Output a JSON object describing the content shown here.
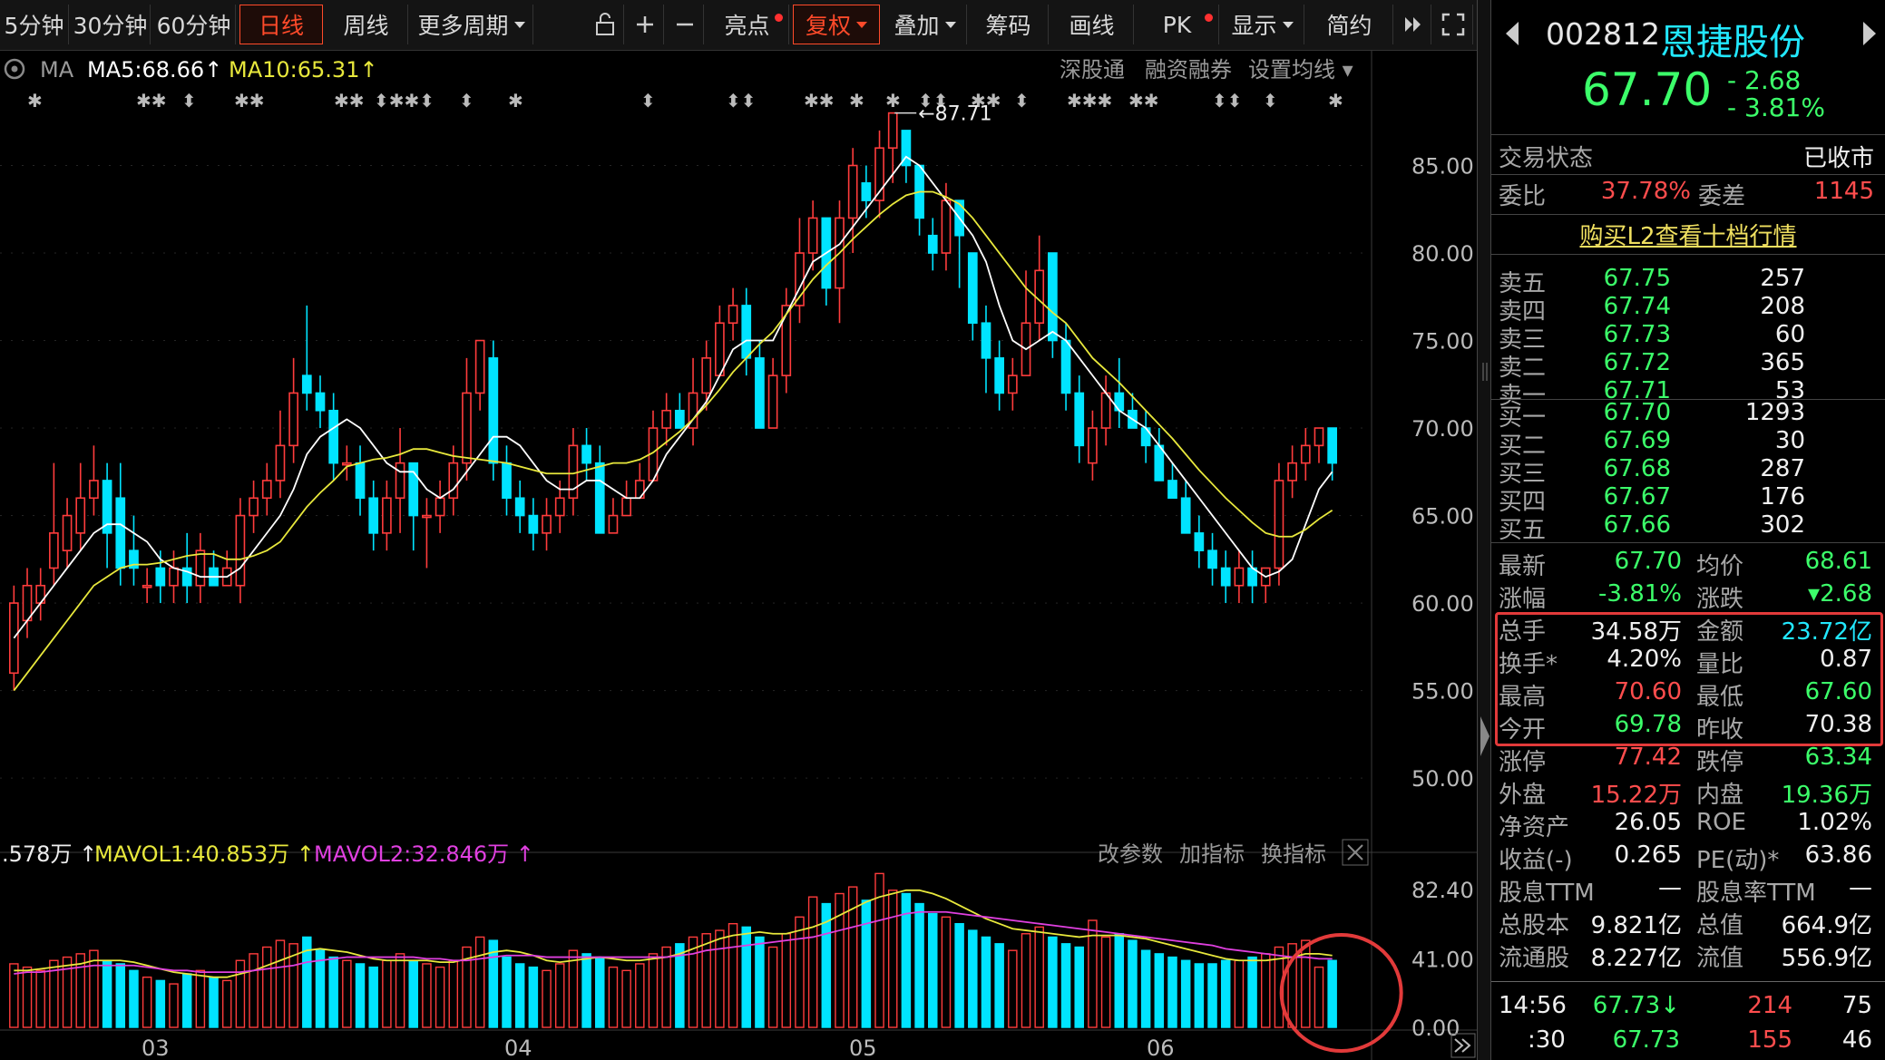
{
  "toolbar": {
    "periods": [
      "5分钟",
      "30分钟",
      "60分钟",
      "日线",
      "周线",
      "更多周期"
    ],
    "active_period": "日线",
    "tools": [
      "亮点",
      "复权",
      "叠加",
      "筹码",
      "画线",
      "PK",
      "显示",
      "简约"
    ],
    "icons": [
      "lock-icon",
      "plus-icon",
      "minus-icon"
    ]
  },
  "ma_legend": {
    "title": "MA",
    "ma5": "MA5:68.66",
    "ma10": "MA10:65.31",
    "arrow": "↑"
  },
  "chart_links": [
    "深股通",
    "融资融券",
    "设置均线"
  ],
  "vol_legend": {
    "vol": ".578万",
    "mavol1": "MAVOL1:40.853万",
    "mavol2": "MAVOL2:32.846万",
    "arrow": "↑"
  },
  "vol_links": [
    "改参数",
    "加指标",
    "换指标"
  ],
  "x_labels": [
    "03",
    "04",
    "05",
    "06"
  ],
  "price_axis": [
    "85.00",
    "80.00",
    "75.00",
    "70.00",
    "65.00",
    "60.00",
    "55.00",
    "50.00"
  ],
  "vol_axis": [
    "82.40",
    "41.00",
    "0.00"
  ],
  "peak_label": "87.71",
  "colors": {
    "up": "#ff3c3c",
    "down": "#00e4ff",
    "ma5": "#ffffff",
    "ma10": "#e8e83c",
    "mavol1": "#e8e83c",
    "mavol2": "#e040e0"
  },
  "chart_data": {
    "type": "candlestick",
    "ylim": [
      47,
      90
    ],
    "vol_ylim": [
      0,
      96
    ],
    "candles": [
      [
        56,
        60,
        61,
        55
      ],
      [
        59,
        61,
        62,
        58
      ],
      [
        60,
        61,
        62,
        59
      ],
      [
        62,
        64,
        68,
        61
      ],
      [
        63,
        65,
        66,
        62
      ],
      [
        64,
        66,
        68,
        63
      ],
      [
        66,
        67,
        69,
        65
      ],
      [
        67,
        64,
        68,
        62
      ],
      [
        66,
        62,
        68,
        61
      ],
      [
        63,
        62,
        65,
        61
      ],
      [
        61,
        61,
        62,
        60
      ],
      [
        62,
        61,
        63,
        60
      ],
      [
        61,
        62,
        63,
        60
      ],
      [
        62,
        61,
        64,
        60
      ],
      [
        61,
        63,
        64,
        60
      ],
      [
        62,
        61,
        63,
        61
      ],
      [
        61,
        62,
        63,
        61
      ],
      [
        61,
        65,
        66,
        60
      ],
      [
        65,
        66,
        67,
        64
      ],
      [
        66,
        67,
        68,
        65
      ],
      [
        67,
        69,
        71,
        66
      ],
      [
        69,
        72,
        74,
        68
      ],
      [
        73,
        72,
        77,
        71
      ],
      [
        72,
        71,
        73,
        70
      ],
      [
        71,
        68,
        72,
        67
      ],
      [
        68,
        68,
        69,
        67
      ],
      [
        68,
        66,
        69,
        65
      ],
      [
        66,
        64,
        67,
        63
      ],
      [
        64,
        66,
        67,
        63
      ],
      [
        66,
        68,
        70,
        64
      ],
      [
        68,
        65,
        68,
        63
      ],
      [
        65,
        65,
        66,
        62
      ],
      [
        65,
        66,
        67,
        64
      ],
      [
        66,
        68,
        69,
        65
      ],
      [
        68,
        72,
        74,
        67
      ],
      [
        72,
        75,
        75,
        71
      ],
      [
        74,
        68,
        75,
        67
      ],
      [
        68,
        66,
        69,
        65
      ],
      [
        66,
        65,
        67,
        64
      ],
      [
        65,
        64,
        66,
        63
      ],
      [
        64,
        65,
        66,
        63
      ],
      [
        65,
        66,
        67,
        64
      ],
      [
        66,
        69,
        70,
        65
      ],
      [
        69,
        68,
        70,
        67
      ],
      [
        68,
        64,
        69,
        64
      ],
      [
        64,
        65,
        66,
        64
      ],
      [
        65,
        66,
        67,
        65
      ],
      [
        66,
        67,
        68,
        66
      ],
      [
        67,
        70,
        71,
        67
      ],
      [
        70,
        71,
        72,
        69
      ],
      [
        71,
        70,
        72,
        70
      ],
      [
        70,
        72,
        74,
        69
      ],
      [
        72,
        74,
        75,
        71
      ],
      [
        73,
        76,
        77,
        73
      ],
      [
        76,
        77,
        78,
        75
      ],
      [
        77,
        74,
        78,
        73
      ],
      [
        74,
        70,
        75,
        70
      ],
      [
        70,
        73,
        74,
        70
      ],
      [
        73,
        77,
        78,
        72
      ],
      [
        77,
        80,
        82,
        76
      ],
      [
        80,
        82,
        83,
        79
      ],
      [
        82,
        78,
        82,
        77
      ],
      [
        78,
        82,
        83,
        76
      ],
      [
        82,
        85,
        86,
        80
      ],
      [
        84,
        83,
        85,
        82
      ],
      [
        83,
        86,
        87,
        82
      ],
      [
        86,
        88,
        88,
        84
      ],
      [
        87,
        85,
        87,
        84
      ],
      [
        85,
        82,
        85,
        81
      ],
      [
        81,
        80,
        82,
        79
      ],
      [
        80,
        83,
        84,
        79
      ],
      [
        83,
        81,
        83,
        78
      ],
      [
        80,
        76,
        80,
        75
      ],
      [
        76,
        74,
        77,
        72
      ],
      [
        74,
        72,
        75,
        71
      ],
      [
        72,
        73,
        74,
        71
      ],
      [
        73,
        76,
        79,
        73
      ],
      [
        76,
        79,
        81,
        75
      ],
      [
        80,
        75,
        80,
        74
      ],
      [
        75,
        72,
        76,
        71
      ],
      [
        72,
        69,
        73,
        68
      ],
      [
        68,
        70,
        71,
        67
      ],
      [
        70,
        72,
        73,
        69
      ],
      [
        72,
        71,
        74,
        70
      ],
      [
        71,
        70,
        72,
        70
      ],
      [
        70,
        69,
        71,
        68
      ],
      [
        69,
        67,
        70,
        67
      ],
      [
        67,
        66,
        68,
        66
      ],
      [
        66,
        64,
        67,
        64
      ],
      [
        64,
        63,
        65,
        62
      ],
      [
        63,
        62,
        64,
        61
      ],
      [
        62,
        61,
        63,
        60
      ],
      [
        61,
        62,
        63,
        60
      ],
      [
        62,
        61,
        63,
        60
      ],
      [
        61,
        62,
        62,
        60
      ],
      [
        62,
        67,
        68,
        61
      ],
      [
        67,
        68,
        69,
        66
      ],
      [
        68,
        69,
        70,
        67
      ],
      [
        69,
        70,
        70,
        68
      ],
      [
        70,
        68,
        70,
        67
      ]
    ],
    "ma5": [
      58,
      59,
      60,
      61,
      62,
      63,
      64,
      64.5,
      64.5,
      64,
      63.5,
      62.5,
      62,
      61.8,
      61.5,
      61.5,
      61.5,
      62,
      63,
      64,
      65,
      66.5,
      68.5,
      69.5,
      70,
      70.5,
      70,
      69,
      68,
      67.5,
      67.5,
      66.5,
      66,
      66.5,
      67.5,
      68.5,
      69.5,
      69.5,
      69,
      68,
      67,
      66.5,
      66.5,
      67,
      67,
      66.5,
      66,
      66,
      67,
      68.5,
      69.5,
      70.5,
      71.5,
      73,
      74.5,
      75,
      75,
      75,
      76.5,
      78,
      79.5,
      80,
      80.5,
      81.5,
      82.5,
      83.5,
      84.5,
      85.5,
      85,
      84,
      83,
      82,
      81,
      79.5,
      77,
      75,
      74.5,
      75,
      75.5,
      75,
      74,
      73,
      72,
      71,
      70.5,
      70,
      69,
      68,
      67,
      66,
      65,
      64,
      63,
      62,
      61.5,
      61.8,
      62.5,
      64.5,
      66.5,
      67.5
    ],
    "ma10": [
      55,
      56,
      57,
      58,
      59,
      60,
      61,
      61.5,
      62,
      62.2,
      62.2,
      62.3,
      62.5,
      62.7,
      62.8,
      62.8,
      62.5,
      62.5,
      62.7,
      63,
      63.5,
      64.5,
      65.5,
      66.3,
      67,
      67.8,
      68,
      68.2,
      68.3,
      68.5,
      68.8,
      68.8,
      68.6,
      68.4,
      68.3,
      68.2,
      68.1,
      68,
      67.8,
      67.6,
      67.4,
      67.4,
      67.4,
      67.6,
      67.8,
      68,
      68,
      68.2,
      68.6,
      69.2,
      69.8,
      70.5,
      71.3,
      72.2,
      73.2,
      74,
      74.8,
      75.5,
      76.5,
      77.5,
      78.5,
      79.3,
      80,
      80.8,
      81.5,
      82.2,
      82.8,
      83.3,
      83.5,
      83.5,
      83.2,
      82.8,
      82,
      81,
      80,
      79,
      78,
      77.3,
      76.6,
      76,
      75,
      74,
      73.3,
      72.6,
      71.8,
      71,
      70.2,
      69.4,
      68.5,
      67.6,
      66.8,
      66,
      65.3,
      64.6,
      64,
      63.8,
      63.8,
      64.2,
      64.8,
      65.3
    ],
    "volume": [
      38,
      36,
      34,
      40,
      42,
      44,
      46,
      40,
      38,
      34,
      30,
      28,
      26,
      32,
      34,
      30,
      28,
      40,
      44,
      48,
      52,
      50,
      54,
      46,
      42,
      40,
      38,
      36,
      40,
      44,
      40,
      38,
      36,
      40,
      48,
      54,
      52,
      42,
      38,
      36,
      34,
      38,
      46,
      44,
      42,
      36,
      34,
      38,
      44,
      48,
      50,
      54,
      56,
      58,
      62,
      60,
      54,
      48,
      56,
      66,
      78,
      74,
      80,
      84,
      76,
      92,
      82,
      80,
      74,
      68,
      66,
      62,
      58,
      54,
      50,
      46,
      56,
      60,
      54,
      50,
      48,
      64,
      54,
      56,
      52,
      46,
      44,
      42,
      40,
      38,
      38,
      40,
      40,
      42,
      44,
      48,
      50,
      52,
      36,
      40
    ],
    "mavol1": [
      34,
      34,
      35,
      36,
      37,
      38,
      40,
      40,
      40,
      39,
      37,
      35,
      33,
      32,
      31,
      30,
      30,
      32,
      34,
      37,
      40,
      43,
      46,
      47,
      46,
      45,
      43,
      41,
      40,
      40,
      40,
      40,
      39,
      39,
      41,
      43,
      45,
      46,
      45,
      43,
      40,
      39,
      40,
      41,
      42,
      41,
      40,
      40,
      41,
      42,
      44,
      47,
      50,
      53,
      55,
      56,
      57,
      56,
      56,
      58,
      60,
      63,
      67,
      71,
      75,
      78,
      80,
      82,
      82,
      80,
      77,
      73,
      69,
      65,
      62,
      59,
      58,
      57,
      56,
      55,
      54,
      55,
      55,
      55,
      54,
      53,
      51,
      49,
      47,
      45,
      43,
      41,
      40,
      40,
      40,
      41,
      42,
      44,
      44,
      43
    ],
    "mavol2": [
      32,
      33,
      33,
      34,
      35,
      36,
      37,
      37,
      37,
      37,
      36,
      35,
      34,
      34,
      33,
      33,
      33,
      33,
      34,
      35,
      36,
      37,
      39,
      40,
      41,
      42,
      42,
      42,
      42,
      42,
      42,
      41,
      41,
      40,
      40,
      41,
      42,
      43,
      43,
      43,
      42,
      42,
      42,
      42,
      42,
      42,
      42,
      42,
      42,
      42,
      43,
      44,
      46,
      47,
      48,
      49,
      50,
      51,
      52,
      53,
      54,
      56,
      58,
      60,
      62,
      64,
      66,
      68,
      69,
      69,
      69,
      68,
      67,
      66,
      65,
      64,
      63,
      62,
      61,
      60,
      59,
      58,
      57,
      56,
      55,
      54,
      53,
      52,
      51,
      50,
      49,
      47,
      46,
      45,
      44,
      43,
      42,
      42,
      41,
      41
    ]
  },
  "quote": {
    "code": "002812",
    "name": "恩捷股份",
    "price": "67.70",
    "change": "- 2.68",
    "change_pct": "- 3.81%",
    "status_label": "交易状态",
    "status": "已收市",
    "wb_label": "委比",
    "wb": "37.78%",
    "wc_label": "委差",
    "wc": "1145",
    "l2_link": "购买L2查看十档行情",
    "asks": [
      [
        "卖五",
        "67.75",
        "257"
      ],
      [
        "卖四",
        "67.74",
        "208"
      ],
      [
        "卖三",
        "67.73",
        "60"
      ],
      [
        "卖二",
        "67.72",
        "365"
      ],
      [
        "卖一",
        "67.71",
        "53"
      ]
    ],
    "bids": [
      [
        "买一",
        "67.70",
        "1293"
      ],
      [
        "买二",
        "67.69",
        "30"
      ],
      [
        "买三",
        "67.68",
        "287"
      ],
      [
        "买四",
        "67.67",
        "176"
      ],
      [
        "买五",
        "67.66",
        "302"
      ]
    ],
    "stats": [
      [
        "最新",
        "67.70",
        "grn",
        "均价",
        "68.61",
        "grn"
      ],
      [
        "涨幅",
        "-3.81%",
        "grn",
        "涨跌",
        "▾2.68",
        "grn"
      ],
      [
        "总手",
        "34.58万",
        "wht",
        "金额",
        "23.72亿",
        "cyn"
      ],
      [
        "换手*",
        "4.20%",
        "wht",
        "量比",
        "0.87",
        "wht"
      ],
      [
        "最高",
        "70.60",
        "red",
        "最低",
        "67.60",
        "grn"
      ],
      [
        "今开",
        "69.78",
        "grn",
        "昨收",
        "70.38",
        "wht"
      ],
      [
        "涨停",
        "77.42",
        "red",
        "跌停",
        "63.34",
        "grn"
      ],
      [
        "外盘",
        "15.22万",
        "red",
        "内盘",
        "19.36万",
        "grn"
      ],
      [
        "净资产",
        "26.05",
        "wht",
        "ROE",
        "1.02%",
        "wht"
      ],
      [
        "收益(-)",
        "0.265",
        "wht",
        "PE(动)*",
        "63.86",
        "wht"
      ],
      [
        "股息TTM",
        "—",
        "wht",
        "股息率TTM",
        "—",
        "wht"
      ],
      [
        "总股本",
        "9.821亿",
        "wht",
        "总值",
        "664.9亿",
        "wht"
      ],
      [
        "流通股",
        "8.227亿",
        "wht",
        "流值",
        "556.9亿",
        "wht"
      ]
    ],
    "ticks": [
      [
        "14:56",
        "67.73↓",
        "214",
        "75"
      ],
      [
        ":30",
        "67.73",
        "155",
        "46"
      ]
    ]
  }
}
